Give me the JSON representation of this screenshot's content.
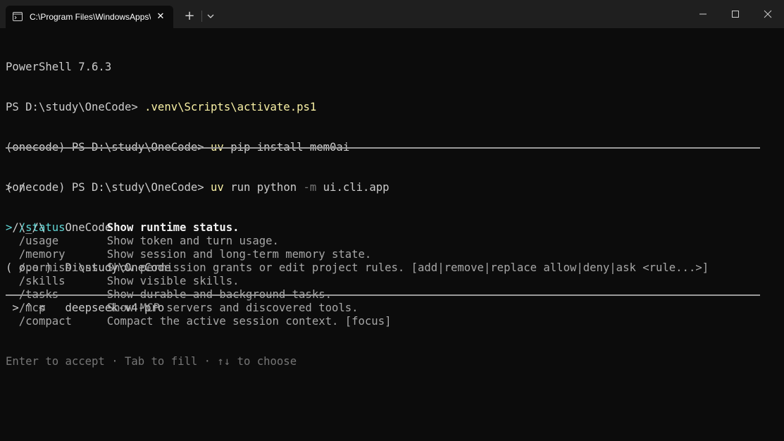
{
  "window": {
    "tab_title": "C:\\Program Files\\WindowsApps\\Microsoft.PowerShell",
    "tab_close": "✕",
    "new_tab": "+"
  },
  "terminal": {
    "banner": "PowerShell 7.6.3",
    "prompt1": "PS D:\\study\\OneCode> ",
    "cmd1": ".venv\\Scripts\\activate.ps1",
    "prompt2": "(onecode) PS D:\\study\\OneCode> ",
    "cmd2_exe": "uv",
    "cmd2_args": " pip install mem0ai",
    "prompt3": "(onecode) PS D:\\study\\OneCode> ",
    "cmd3_exe": "uv",
    "cmd3_pre": " run python ",
    "cmd3_flag": "-m",
    "cmd3_post": " ui.cli.app",
    "ascii1": " /\\_/\\   OneCode",
    "ascii2": "( o.o )  D:\\study\\OneCode",
    "ascii3": " > ^ <   deepseek-v4-pro",
    "input_prompt": "> /",
    "selected_marker": "> ",
    "commands": [
      {
        "name": "/status",
        "desc": "Show runtime status."
      },
      {
        "name": "/usage",
        "desc": "Show token and turn usage."
      },
      {
        "name": "/memory",
        "desc": "Show session and long-term memory state."
      },
      {
        "name": "/permissions",
        "desc": "Show permission grants or edit project rules. [add|remove|replace allow|deny|ask <rule...>]"
      },
      {
        "name": "/skills",
        "desc": "Show visible skills."
      },
      {
        "name": "/tasks",
        "desc": "Show durable and background tasks."
      },
      {
        "name": "/mcp",
        "desc": "Show MCP servers and discovered tools."
      },
      {
        "name": "/compact",
        "desc": "Compact the active session context. [focus]"
      }
    ],
    "footer_hint": "Enter to accept · Tab to fill · ↑↓ to choose"
  },
  "colors": {
    "background": "#0c0c0c",
    "titlebar": "#1f1f1f",
    "command_yellow": "#f9f1a5",
    "selected_cyan": "#61d6d6",
    "hint_gray": "#767676"
  }
}
